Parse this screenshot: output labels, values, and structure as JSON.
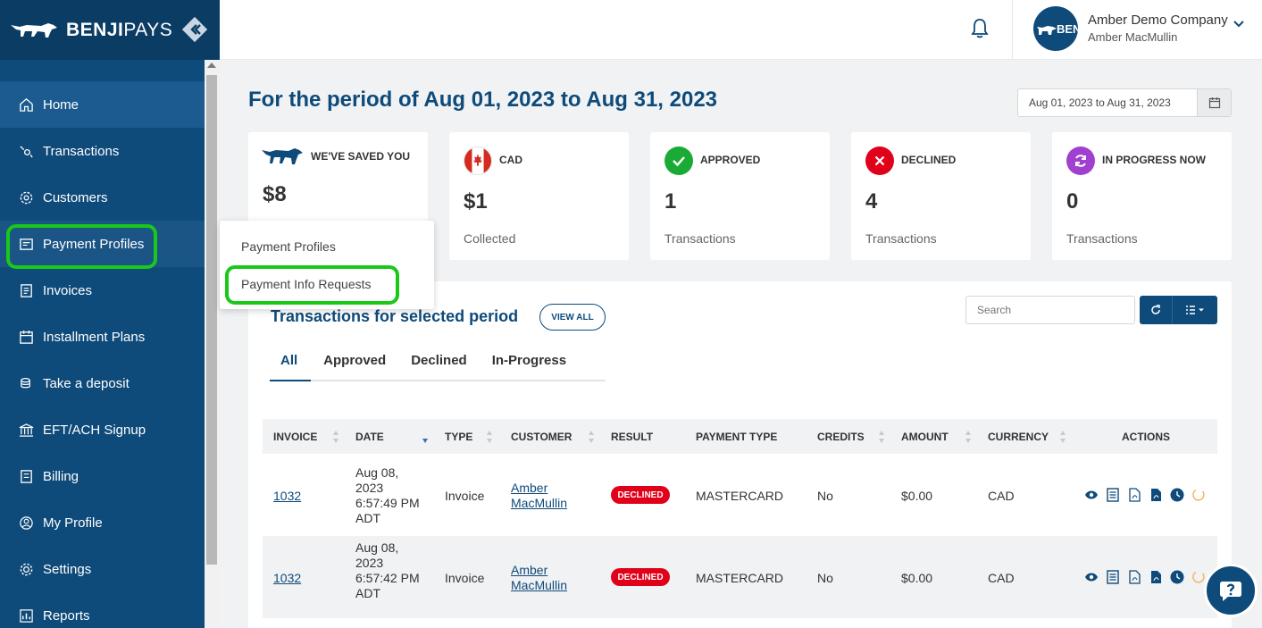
{
  "brand": {
    "name_bold": "BENJI",
    "name_light": "PAYS"
  },
  "sidebar": {
    "items": [
      {
        "label": "Home",
        "icon": "home-icon"
      },
      {
        "label": "Transactions",
        "icon": "transactions-icon"
      },
      {
        "label": "Customers",
        "icon": "customers-icon"
      },
      {
        "label": "Payment Profiles",
        "icon": "payment-profiles-icon"
      },
      {
        "label": "Invoices",
        "icon": "invoices-icon"
      },
      {
        "label": "Installment Plans",
        "icon": "calendar-icon"
      },
      {
        "label": "Take a deposit",
        "icon": "deposit-icon"
      },
      {
        "label": "EFT/ACH Signup",
        "icon": "bank-icon"
      },
      {
        "label": "Billing",
        "icon": "billing-icon"
      },
      {
        "label": "My Profile",
        "icon": "user-icon"
      },
      {
        "label": "Settings",
        "icon": "gear-icon"
      },
      {
        "label": "Reports",
        "icon": "reports-icon"
      }
    ]
  },
  "submenu": {
    "items": [
      "Payment Profiles",
      "Payment Info Requests"
    ]
  },
  "header": {
    "company": "Amber Demo Company",
    "user": "Amber MacMullin",
    "avatar_text": "BEN"
  },
  "page": {
    "title": "For the period of Aug 01, 2023 to Aug 31, 2023",
    "date_range": "Aug 01, 2023 to Aug 31, 2023"
  },
  "cards": [
    {
      "label": "WE'VE SAVED YOU",
      "value": "$8",
      "sub": ""
    },
    {
      "label": "CAD",
      "value": "$1",
      "sub": "Collected"
    },
    {
      "label": "APPROVED",
      "value": "1",
      "sub": "Transactions"
    },
    {
      "label": "DECLINED",
      "value": "4",
      "sub": "Transactions"
    },
    {
      "label": "IN PROGRESS NOW",
      "value": "0",
      "sub": "Transactions"
    }
  ],
  "transactions": {
    "title": "Transactions for selected period",
    "view_all": "VIEW ALL",
    "search_placeholder": "Search",
    "tabs": [
      "All",
      "Approved",
      "Declined",
      "In-Progress"
    ],
    "columns": [
      "INVOICE",
      "DATE",
      "TYPE",
      "CUSTOMER",
      "RESULT",
      "PAYMENT TYPE",
      "CREDITS",
      "AMOUNT",
      "CURRENCY",
      "ACTIONS"
    ],
    "rows": [
      {
        "invoice": "1032",
        "date_l1": "Aug 08,",
        "date_l2": "2023",
        "date_l3": "6:57:49 PM",
        "date_l4": "ADT",
        "type": "Invoice",
        "customer_l1": "Amber",
        "customer_l2": "MacMullin",
        "result": "DECLINED",
        "payment_type": "MASTERCARD",
        "credits": "No",
        "amount": "$0.00",
        "currency": "CAD"
      },
      {
        "invoice": "1032",
        "date_l1": "Aug 08,",
        "date_l2": "2023",
        "date_l3": "6:57:42 PM",
        "date_l4": "ADT",
        "type": "Invoice",
        "customer_l1": "Amber",
        "customer_l2": "MacMullin",
        "result": "DECLINED",
        "payment_type": "MASTERCARD",
        "credits": "No",
        "amount": "$0.00",
        "currency": "CAD"
      }
    ]
  },
  "colors": {
    "brand_navy": "#0e4a7a",
    "highlight_green": "#19c819",
    "declined_red": "#e0001a",
    "approved_green": "#1aab37",
    "progress_purple": "#a13fd0"
  }
}
